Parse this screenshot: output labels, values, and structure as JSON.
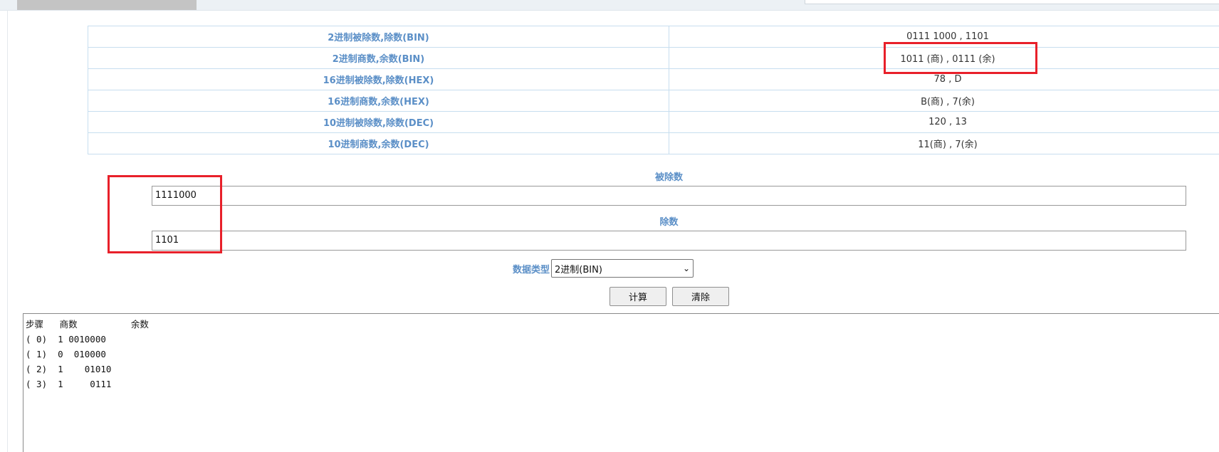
{
  "results": [
    {
      "label": "2进制被除数,除数(BIN)",
      "value": "0111 1000 , 1101"
    },
    {
      "label": "2进制商数,余数(BIN)",
      "value": "1011 (商) , 0111 (余)"
    },
    {
      "label": "16进制被除数,除数(HEX)",
      "value": "78 , D"
    },
    {
      "label": "16进制商数,余数(HEX)",
      "value": "B(商) , 7(余)"
    },
    {
      "label": "10进制被除数,除数(DEC)",
      "value": "120 , 13"
    },
    {
      "label": "10进制商数,余数(DEC)",
      "value": "11(商) , 7(余)"
    }
  ],
  "dividend": {
    "label": "被除数",
    "value": "1111000"
  },
  "divisor": {
    "label": "除数",
    "value": "1101"
  },
  "data_type": {
    "label": "数据类型",
    "selected": "2进制(BIN)"
  },
  "buttons": {
    "calculate": "计算",
    "clear": "清除"
  },
  "output": {
    "header": "步骤   商数          余数",
    "lines": [
      "( 0)  1 0010000",
      "( 1)  0  010000",
      "( 2)  1    01010",
      "( 3)  1     0111"
    ]
  },
  "colors": {
    "label_blue": "#5b8fc7",
    "annotation_red": "#e8202a",
    "table_border": "#c7deef"
  }
}
